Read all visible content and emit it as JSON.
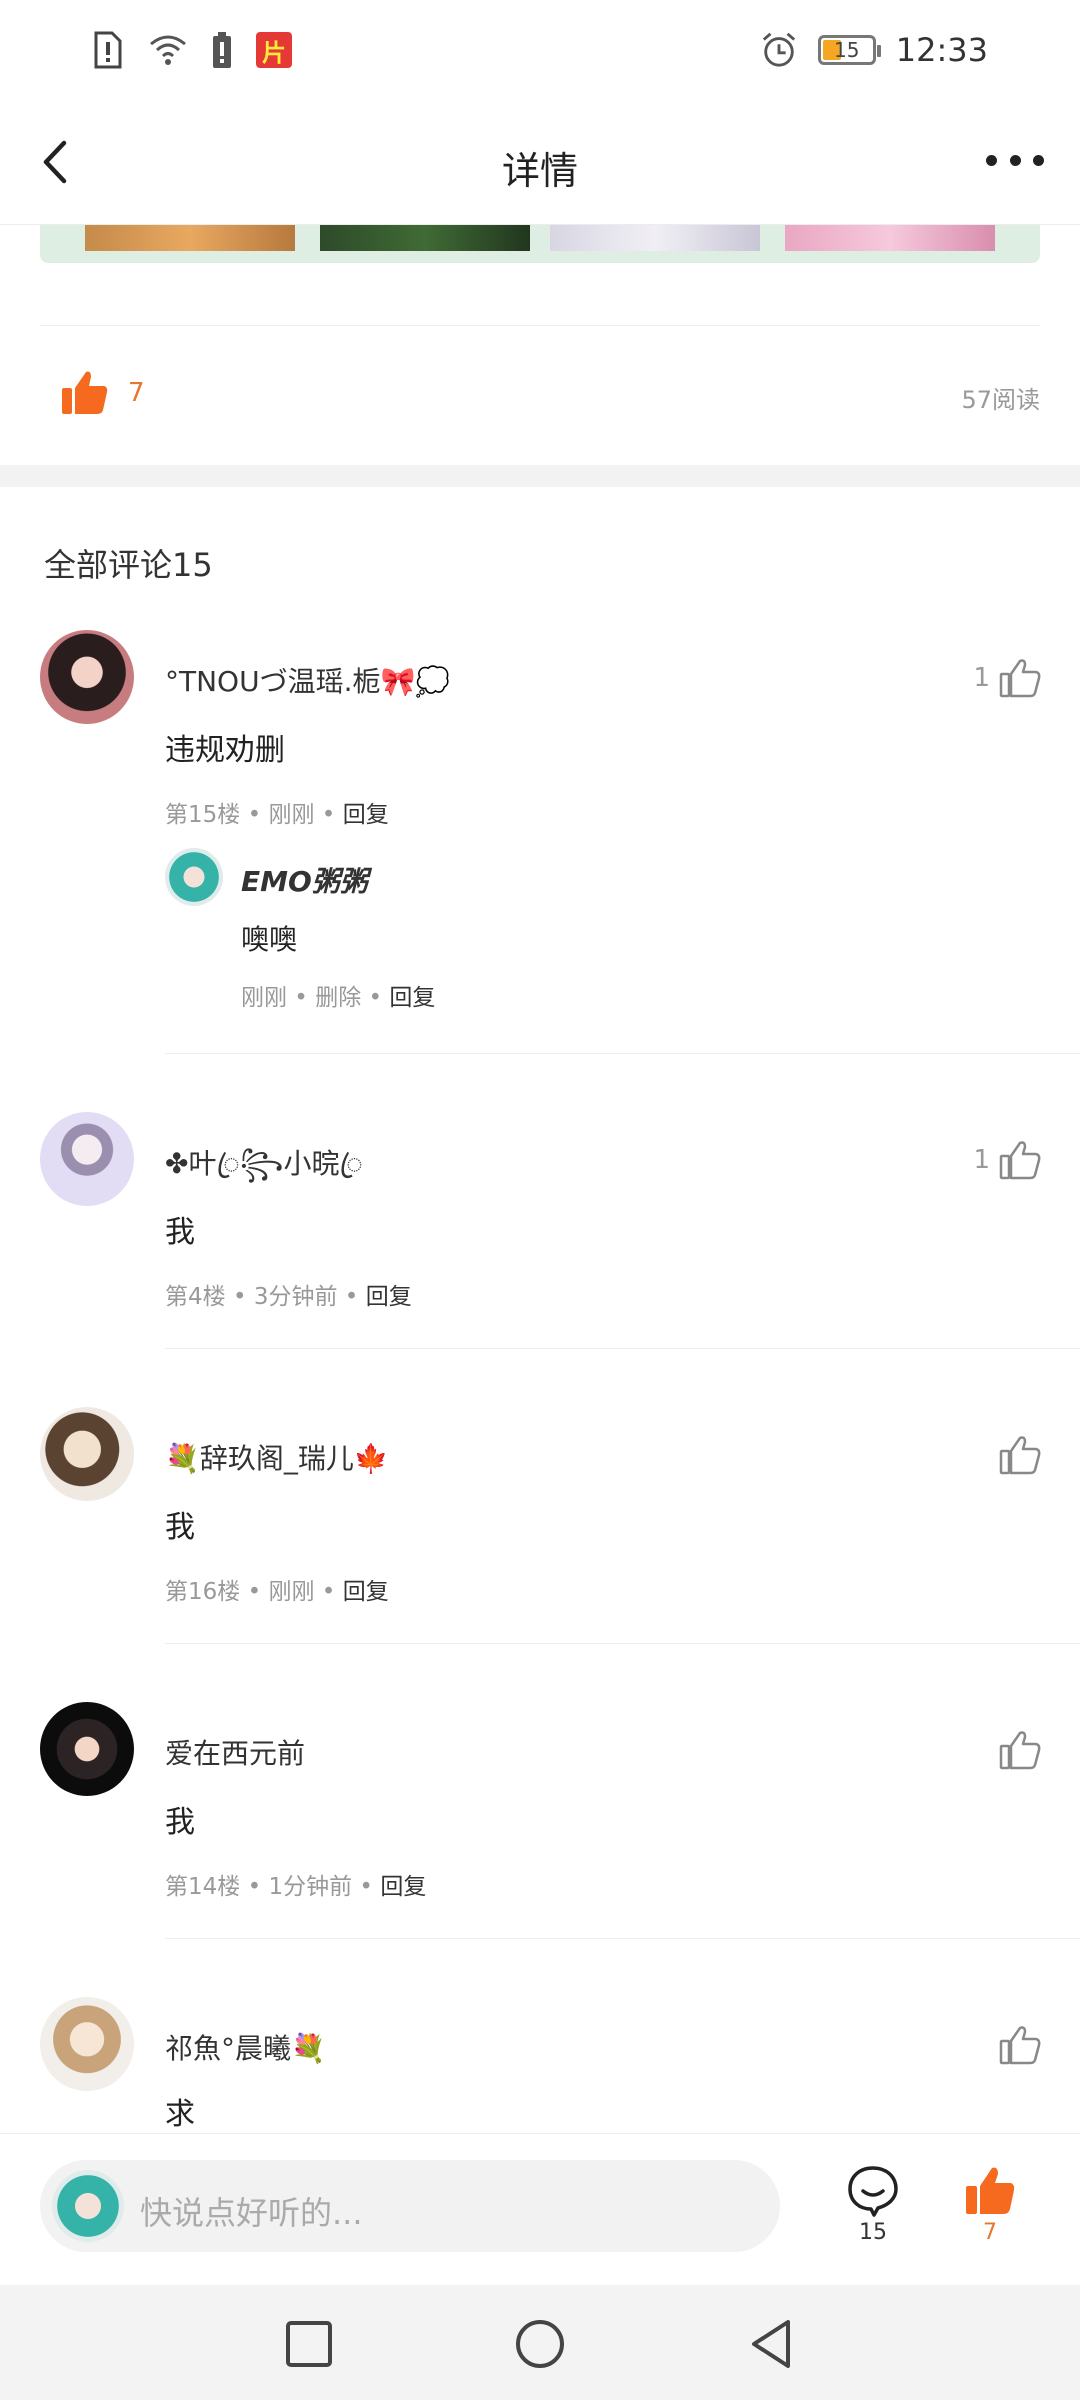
{
  "status_bar": {
    "time": "12:33",
    "battery": "15",
    "app_badge": "片"
  },
  "nav": {
    "title": "详情"
  },
  "post": {
    "like_count": "7",
    "read_count": "57阅读"
  },
  "comments_title": "全部评论15",
  "comments": [
    {
      "name": "°TNOUづ温瑶.栀🎀💭",
      "text": "违规劝删",
      "meta_floor": "第15楼",
      "meta_time": "刚刚",
      "reply_label": "回复",
      "likes": "1",
      "sub_replies": [
        {
          "name": "EMO粥粥",
          "text": "噢噢",
          "meta_time": "刚刚",
          "meta_delete": "删除",
          "reply_label": "回复"
        }
      ]
    },
    {
      "name": "✤叶ꦿ꧂小晥ꦿ",
      "text": "我",
      "meta_floor": "第4楼",
      "meta_time": "3分钟前",
      "reply_label": "回复",
      "likes": "1"
    },
    {
      "name": "💐辞玖阁_瑞儿🍁",
      "text": "我",
      "meta_floor": "第16楼",
      "meta_time": "刚刚",
      "reply_label": "回复",
      "likes": ""
    },
    {
      "name": "爱在西元前",
      "text": "我",
      "meta_floor": "第14楼",
      "meta_time": "1分钟前",
      "reply_label": "回复",
      "likes": ""
    },
    {
      "name": "祁魚°晨曦💐",
      "text": "求",
      "likes": ""
    }
  ],
  "bottom_bar": {
    "placeholder": "快说点好听的...",
    "comment_count": "15",
    "like_count": "7"
  },
  "colors": {
    "accent": "#f56a1f",
    "like_text": "#e8772e",
    "muted": "#999999"
  }
}
